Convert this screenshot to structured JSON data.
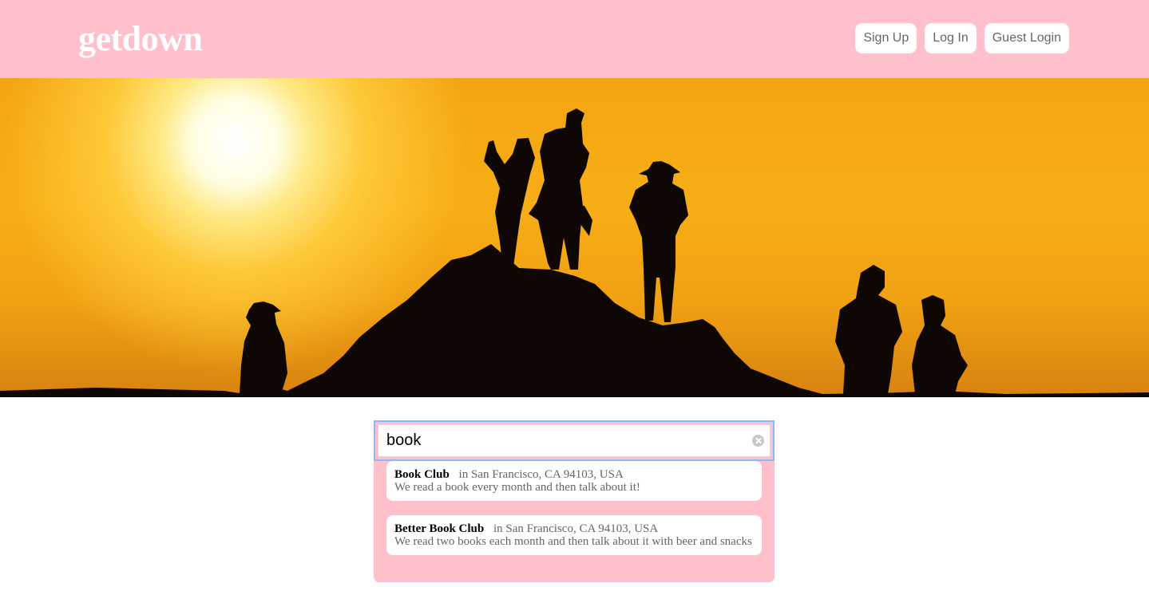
{
  "header": {
    "logo": "getdown",
    "nav": [
      {
        "label": "Sign Up"
      },
      {
        "label": "Log In"
      },
      {
        "label": "Guest Login"
      }
    ]
  },
  "colors": {
    "brand_pink": "#ffc0cb",
    "focus_ring": "#8db8f2",
    "sky_orange": "#f3a512"
  },
  "search": {
    "value": "book",
    "clear_icon": "clear-circle-icon",
    "results": [
      {
        "name": "Book Club",
        "location": "in San Francisco, CA 94103, USA",
        "description": "We read a book every month and then talk about it!"
      },
      {
        "name": "Better Book Club",
        "location": "in San Francisco, CA 94103, USA",
        "description": "We read two books each month and then talk about it with beer and snacks"
      }
    ]
  }
}
